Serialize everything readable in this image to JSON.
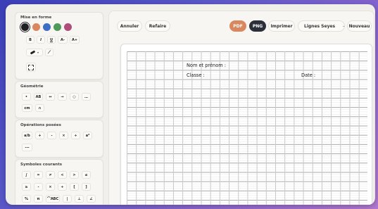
{
  "sidebar": {
    "formatting": {
      "title": "Mise en forme",
      "colors": [
        "#1f1f24",
        "#d9875f",
        "#3b6ec4",
        "#4e9a5c",
        "#b04d7a"
      ],
      "style_buttons": [
        "B",
        "I",
        "U",
        "A-",
        "A+"
      ]
    },
    "geometry": {
      "title": "Géométrie",
      "row1": [
        "•",
        "AB",
        "↔",
        "→",
        "○",
        "…"
      ],
      "row2": [
        "cm",
        "∩"
      ]
    },
    "operations": {
      "title": "Opérations posées",
      "row1": [
        "a/b",
        "+",
        "-",
        "×",
        "÷",
        "a²"
      ],
      "row2": [
        "---"
      ]
    },
    "symbols": {
      "title": "Symboles courants",
      "row1": [
        "∫",
        "=",
        "≠",
        "<",
        ">",
        "≤"
      ],
      "row2": [
        "≥",
        "-",
        "×",
        "÷",
        "[",
        "]"
      ],
      "row3": [
        "%",
        "π",
        "⌒ABC",
        "|",
        "⊥",
        "∠"
      ]
    }
  },
  "toolbar": {
    "undo": "Annuler",
    "redo": "Refaire",
    "pdf": "PDF",
    "png": "PNG",
    "print": "Imprimer",
    "lines_select": "Lignes Seyes",
    "new": "Nouveau"
  },
  "paper": {
    "name_label": "Nom et prénom :",
    "class_label": "Classe :",
    "date_label": "Date :"
  }
}
